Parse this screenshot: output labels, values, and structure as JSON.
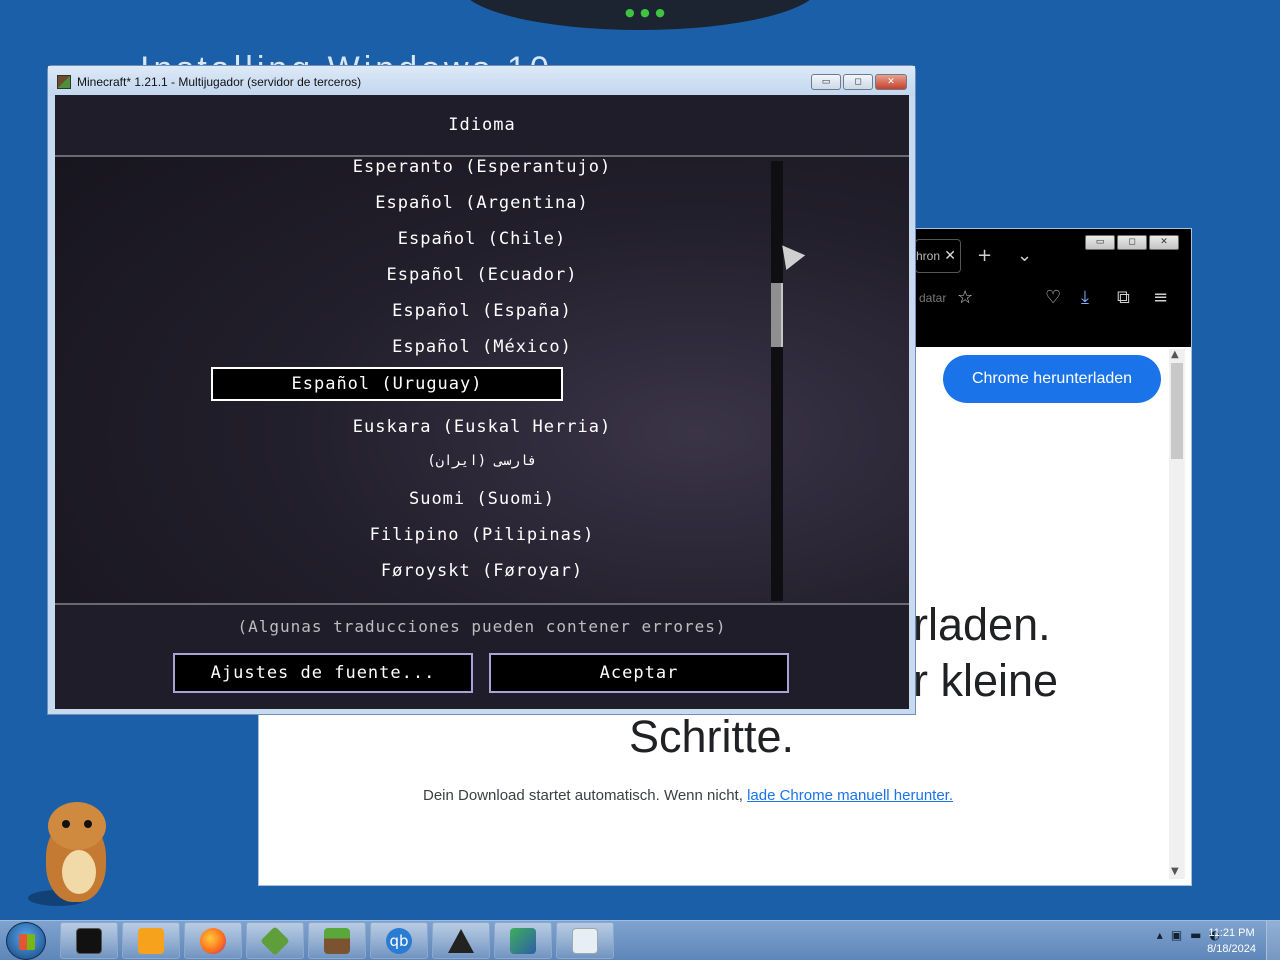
{
  "desktop": {
    "background_color": "#1a5fa8",
    "faint_text": "Installing Windows 10"
  },
  "browser": {
    "tab_fragment": "hron",
    "url_fragment": "datar",
    "primary_button": "Chrome herunterladen",
    "heading_lines": [
      "rladen.",
      "r kleine",
      "Schritte."
    ],
    "download_text": "Dein Download startet automatisch. Wenn nicht, ",
    "download_link": "lade Chrome manuell herunter.",
    "accent": "#1a73e8"
  },
  "minecraft": {
    "window_title": "Minecraft* 1.21.1 - Multijugador (servidor de terceros)",
    "screen_title": "Idioma",
    "languages": [
      "Esperanto (Esperantujo)",
      "Español (Argentina)",
      "Español (Chile)",
      "Español (Ecuador)",
      "Español (España)",
      "Español (México)",
      "Español (Uruguay)",
      "Euskara (Euskal Herria)",
      "فارسی (ایران)",
      "Suomi (Suomi)",
      "Filipino (Pilipinas)",
      "Føroyskt (Føroyar)"
    ],
    "selected_language": "Español (Uruguay)",
    "footer_note": "(Algunas traducciones pueden contener errores)",
    "font_settings_button": "Ajustes de fuente...",
    "accept_button": "Aceptar"
  },
  "taskbar": {
    "apps": [
      "terminal",
      "media-player",
      "firefox",
      "minecraft-launcher",
      "minecraft",
      "qbittorrent",
      "inkscape",
      "vpn",
      "file-manager"
    ],
    "clock_time": "11:21 PM",
    "clock_date": "8/18/2024"
  }
}
